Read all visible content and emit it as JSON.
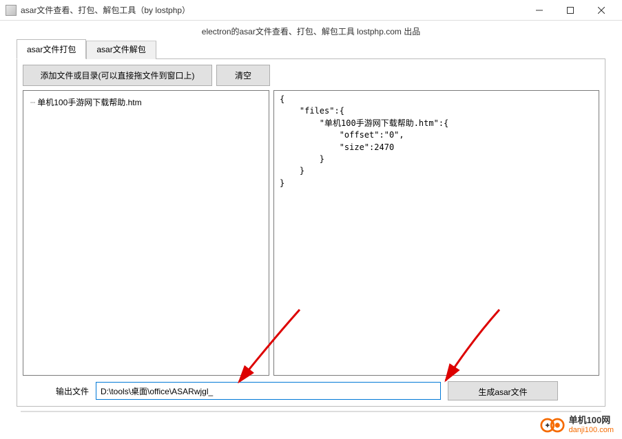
{
  "window": {
    "title": "asar文件查看、打包、解包工具（by lostphp）"
  },
  "subtitle": "electron的asar文件查看、打包、解包工具 lostphp.com 出品",
  "tabs": {
    "pack": "asar文件打包",
    "unpack": "asar文件解包"
  },
  "buttons": {
    "add": "添加文件或目录(可以直接拖文件到窗口上)",
    "clear": "清空",
    "generate": "生成asar文件"
  },
  "fileTree": {
    "items": [
      "单机100手游网下载帮助.htm"
    ]
  },
  "jsonPreview": "{\n    \"files\":{\n        \"单机100手游网下载帮助.htm\":{\n            \"offset\":\"0\",\n            \"size\":2470\n        }\n    }\n}",
  "output": {
    "label": "输出文件",
    "value": "D:\\tools\\桌面\\office\\ASARwjgl_"
  },
  "watermark": {
    "name": "单机100网",
    "url": "danji100.com"
  }
}
